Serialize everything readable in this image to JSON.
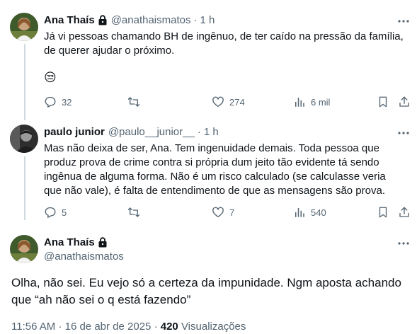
{
  "tweets": [
    {
      "name": "Ana Thaís",
      "handle": "@anathaismatos",
      "time": "1 h",
      "text": "Já vi pessoas chamando BH de ingênuo, de ter caído na pressão da família, de querer ajudar o próximo.",
      "emoji": "😒",
      "replies": "32",
      "retweets": "",
      "likes": "274",
      "views": "6 mil"
    },
    {
      "name": "paulo junior",
      "handle": "@paulo__junior__",
      "time": "1 h",
      "text": "Mas não deixa de ser, Ana. Tem ingenuidade demais. Toda pessoa que produz prova de crime contra si própria dum jeito tão evidente tá sendo ingênua de alguma forma. Não é um risco calculado (se calculasse veria que não vale), é falta de entendimento de que as mensagens são prova.",
      "replies": "5",
      "retweets": "",
      "likes": "7",
      "views": "540"
    }
  ],
  "focused": {
    "name": "Ana Thaís",
    "handle": "@anathaismatos",
    "text": "Olha, não sei. Eu vejo só a certeza da impunidade. Ngm aposta achando que “ah não sei o q está fazendo”",
    "time": "11:56 AM",
    "date": "16 de abr de 2025",
    "views_count": "420",
    "views_label": "Visualizações"
  },
  "icons": {
    "reply": "reply-icon",
    "retweet": "retweet-icon",
    "like": "heart-icon",
    "views": "views-icon",
    "bookmark": "bookmark-icon",
    "share": "share-icon",
    "more": "more-icon",
    "lock": "lock-icon"
  },
  "colors": {
    "text": "#0f1419",
    "secondary": "#536471",
    "thread_line": "#cfd9de"
  }
}
